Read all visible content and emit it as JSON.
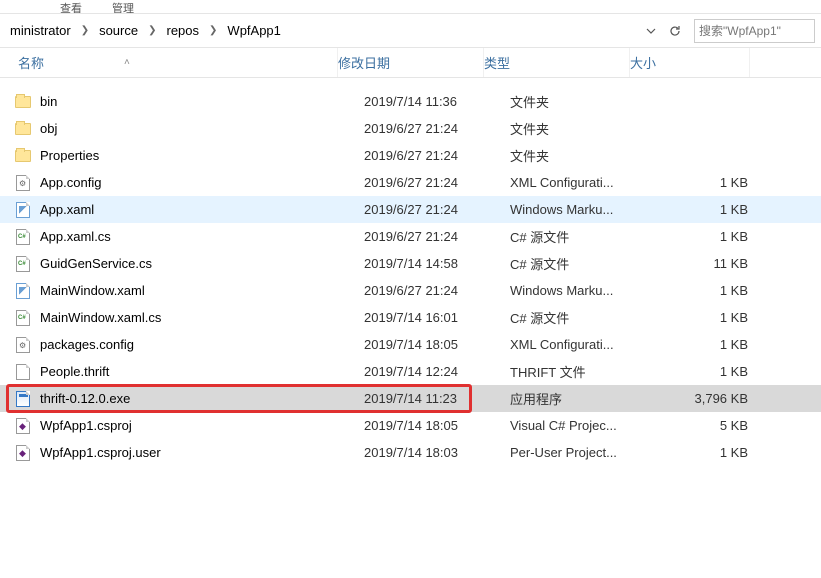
{
  "topStrip": {
    "item1": "查看",
    "item2": "管理"
  },
  "breadcrumbs": {
    "crumb0": "ministrator",
    "crumb1": "source",
    "crumb2": "repos",
    "crumb3": "WpfApp1"
  },
  "search": {
    "placeholder": "搜索\"WpfApp1\""
  },
  "headers": {
    "name": "名称",
    "date": "修改日期",
    "type": "类型",
    "size": "大小"
  },
  "rows": [
    {
      "icon": "folder",
      "name": "bin",
      "date": "2019/7/14 11:36",
      "type": "文件夹",
      "size": ""
    },
    {
      "icon": "folder",
      "name": "obj",
      "date": "2019/6/27 21:24",
      "type": "文件夹",
      "size": ""
    },
    {
      "icon": "folder",
      "name": "Properties",
      "date": "2019/6/27 21:24",
      "type": "文件夹",
      "size": ""
    },
    {
      "icon": "config",
      "name": "App.config",
      "date": "2019/6/27 21:24",
      "type": "XML Configurati...",
      "size": "1 KB"
    },
    {
      "icon": "xaml",
      "name": "App.xaml",
      "date": "2019/6/27 21:24",
      "type": "Windows Marku...",
      "size": "1 KB",
      "state": "hover"
    },
    {
      "icon": "cs",
      "name": "App.xaml.cs",
      "date": "2019/6/27 21:24",
      "type": "C# 源文件",
      "size": "1 KB"
    },
    {
      "icon": "cs",
      "name": "GuidGenService.cs",
      "date": "2019/7/14 14:58",
      "type": "C# 源文件",
      "size": "11 KB"
    },
    {
      "icon": "xaml",
      "name": "MainWindow.xaml",
      "date": "2019/6/27 21:24",
      "type": "Windows Marku...",
      "size": "1 KB"
    },
    {
      "icon": "cs",
      "name": "MainWindow.xaml.cs",
      "date": "2019/7/14 16:01",
      "type": "C# 源文件",
      "size": "1 KB"
    },
    {
      "icon": "config",
      "name": "packages.config",
      "date": "2019/7/14 18:05",
      "type": "XML Configurati...",
      "size": "1 KB"
    },
    {
      "icon": "file",
      "name": "People.thrift",
      "date": "2019/7/14 12:24",
      "type": "THRIFT 文件",
      "size": "1 KB"
    },
    {
      "icon": "exe",
      "name": "thrift-0.12.0.exe",
      "date": "2019/7/14 11:23",
      "type": "应用程序",
      "size": "3,796 KB",
      "state": "selected",
      "highlight": true
    },
    {
      "icon": "vs",
      "name": "WpfApp1.csproj",
      "date": "2019/7/14 18:05",
      "type": "Visual C# Projec...",
      "size": "5 KB"
    },
    {
      "icon": "vs",
      "name": "WpfApp1.csproj.user",
      "date": "2019/7/14 18:03",
      "type": "Per-User Project...",
      "size": "1 KB"
    }
  ]
}
